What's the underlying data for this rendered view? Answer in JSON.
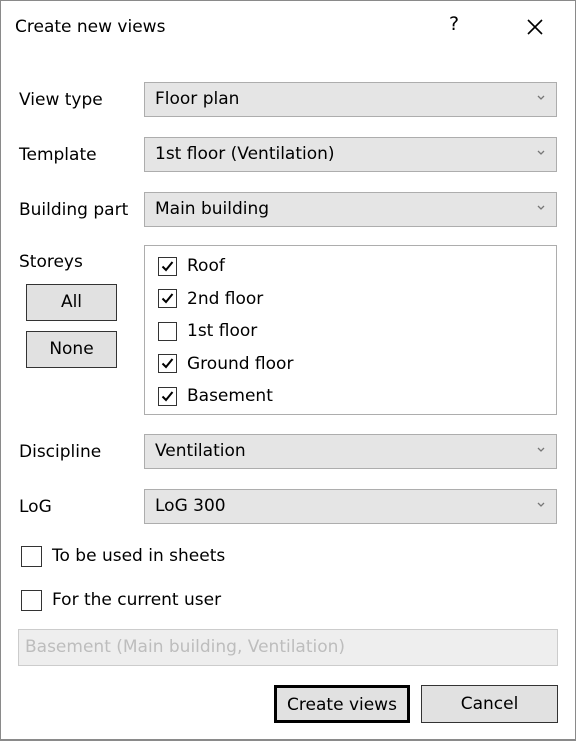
{
  "dialog": {
    "title": "Create new views",
    "help_label": "?",
    "close_icon": "close-icon"
  },
  "fields": {
    "view_type": {
      "label": "View type",
      "value": "Floor plan"
    },
    "template": {
      "label": "Template",
      "value": "1st floor (Ventilation)"
    },
    "building_part": {
      "label": "Building part",
      "value": "Main building"
    },
    "discipline": {
      "label": "Discipline",
      "value": "Ventilation"
    },
    "log": {
      "label": "LoG",
      "value": "LoG 300"
    }
  },
  "storeys": {
    "label": "Storeys",
    "all_label": "All",
    "none_label": "None",
    "items": [
      {
        "label": "Roof",
        "checked": true
      },
      {
        "label": "2nd floor",
        "checked": true
      },
      {
        "label": "1st floor",
        "checked": false
      },
      {
        "label": "Ground floor",
        "checked": true
      },
      {
        "label": "Basement",
        "checked": true
      }
    ]
  },
  "options": {
    "sheets": {
      "label": "To be used in sheets",
      "checked": false
    },
    "current_user": {
      "label": "For the current user",
      "checked": false
    }
  },
  "preview_name": "Basement (Main building, Ventilation)",
  "buttons": {
    "create": "Create views",
    "cancel": "Cancel"
  }
}
